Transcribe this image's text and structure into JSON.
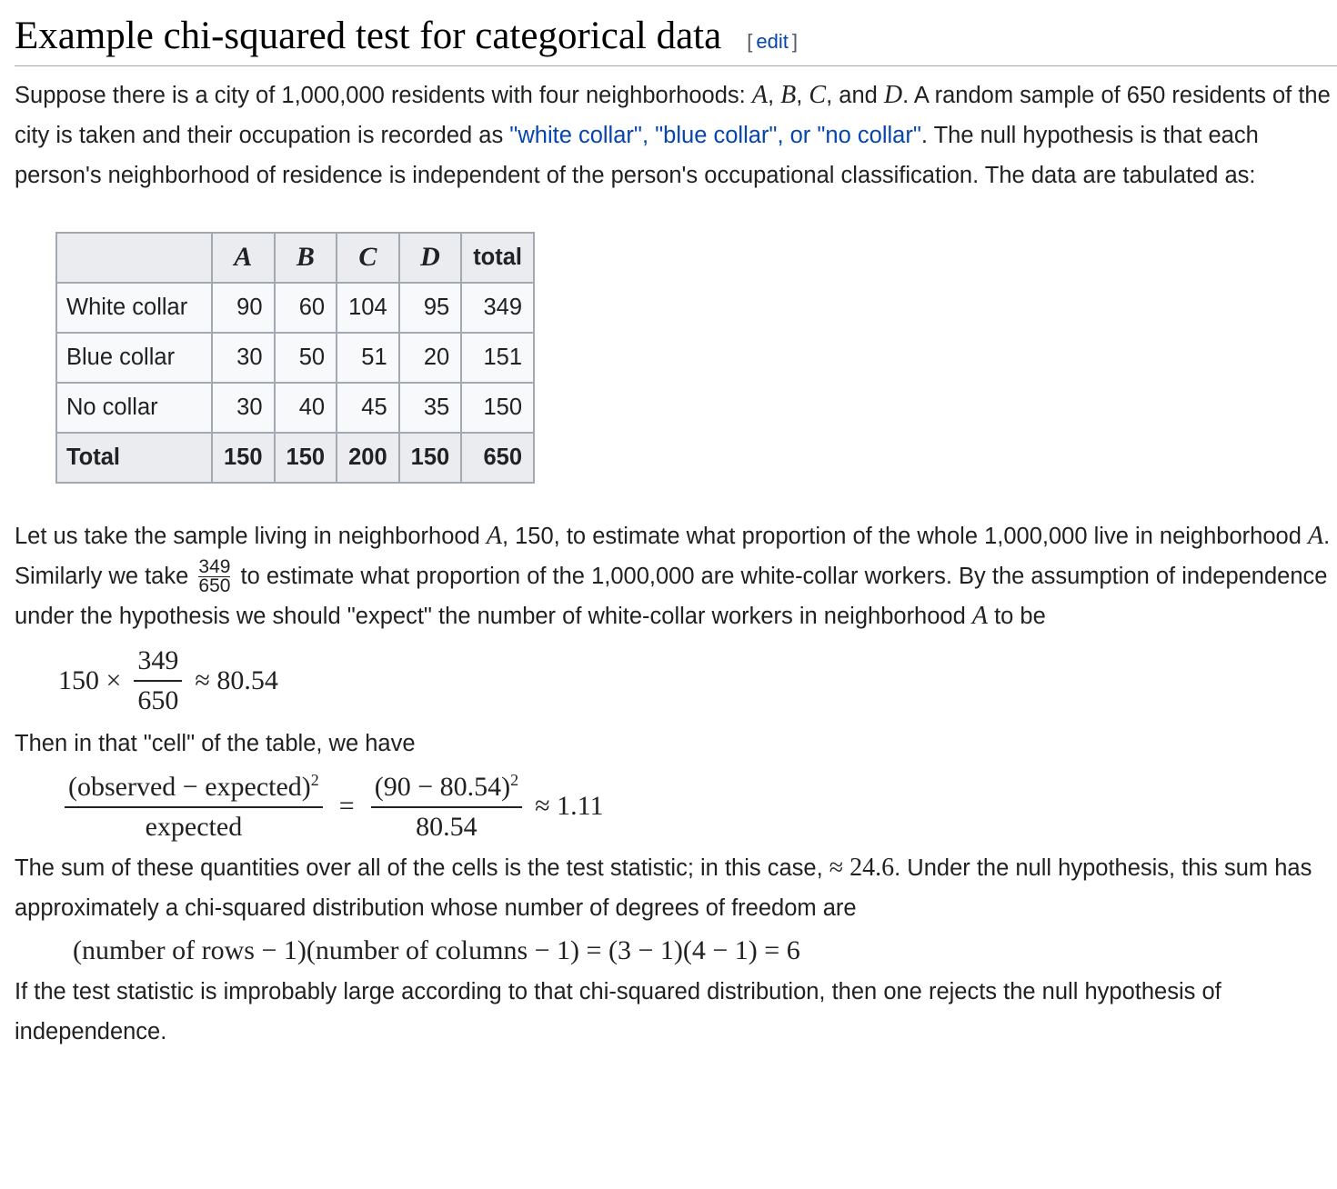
{
  "heading": {
    "title": "Example chi-squared test for categorical data",
    "edit_open": "[",
    "edit_label": "edit",
    "edit_close": "]"
  },
  "para1": {
    "t1": "Suppose there is a city of 1,000,000 residents with four neighborhoods: ",
    "A": "A",
    "comma1": ", ",
    "B": "B",
    "comma2": ", ",
    "C": "C",
    "and": ", and ",
    "D": "D",
    "t2": ". A random sample of 650 residents of the city is taken and their occupation is recorded as ",
    "link": "\"white collar\", \"blue collar\", or \"no collar\"",
    "t3": ". The null hypothesis is that each person's neighborhood of residence is independent of the person's occupational classification. The data are tabulated as:"
  },
  "table": {
    "headers": [
      "",
      "A",
      "B",
      "C",
      "D",
      "total"
    ],
    "rows": [
      {
        "label": "White collar",
        "values": [
          "90",
          "60",
          "104",
          "95",
          "349"
        ]
      },
      {
        "label": "Blue collar",
        "values": [
          "30",
          "50",
          "51",
          "20",
          "151"
        ]
      },
      {
        "label": "No collar",
        "values": [
          "30",
          "40",
          "45",
          "35",
          "150"
        ]
      }
    ],
    "total_row": {
      "label": "Total",
      "values": [
        "150",
        "150",
        "200",
        "150",
        "650"
      ]
    }
  },
  "para2": {
    "t1": "Let us take the sample living in neighborhood ",
    "A1": "A",
    "t2": ", 150, to estimate what proportion of the whole 1,000,000 live in neighborhood ",
    "A2": "A",
    "t3": ". Similarly we take ",
    "frac_num": "349",
    "frac_den": "650",
    "t4": " to estimate what proportion of the 1,000,000 are white-collar workers. By the assumption of independence under the hypothesis we should \"expect\" the number of white-collar workers in neighborhood ",
    "A3": "A",
    "t5": " to be"
  },
  "eq1": {
    "left": "150 ×",
    "num": "349",
    "den": "650",
    "right": "≈ 80.54"
  },
  "para3": "Then in that \"cell\" of the table, we have",
  "eq2": {
    "num1": "(observed − expected)",
    "sup1": "2",
    "den1": "expected",
    "eq": "=",
    "num2": "(90 − 80.54)",
    "sup2": "2",
    "den2": "80.54",
    "right": "≈ 1.11"
  },
  "para4": {
    "t1": "The sum of these quantities over all of the cells is the test statistic; in this case, ",
    "math": "≈ 24.6",
    "t2": ". Under the null hypothesis, this sum has approximately a chi-squared distribution whose number of degrees of freedom are"
  },
  "eq3": "(number of rows − 1)(number of columns − 1) = (3 − 1)(4 − 1) = 6",
  "para5": "If the test statistic is improbably large according to that chi-squared distribution, then one rejects the null hypothesis of independence."
}
